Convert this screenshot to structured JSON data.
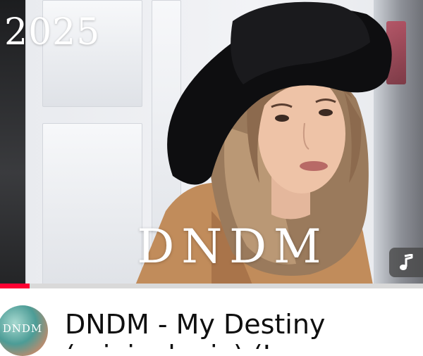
{
  "thumbnail": {
    "year_text": "2025",
    "brand_text": "DNDM",
    "music_icon": "music-note-icon"
  },
  "player": {
    "progress_fraction": 0.07,
    "progress_color": "#ff0033"
  },
  "video": {
    "title_line1": "DNDM - My Destiny",
    "title_line2": "(original mix) (L...",
    "channel_avatar_text": "DNDM"
  }
}
